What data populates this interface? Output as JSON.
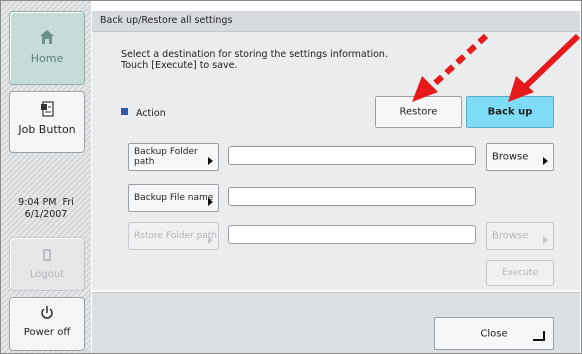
{
  "sidebar": {
    "home_label": "Home",
    "job_label": "Job Button",
    "time": "9:04 PM  Fri",
    "date": "6/1/2007",
    "logout_label": "Logout",
    "power_label": "Power off"
  },
  "window": {
    "title": "Back up/Restore all settings"
  },
  "instructions": {
    "line1": "Select a destination for storing the settings information.",
    "line2": "Touch [Execute] to save."
  },
  "action": {
    "label": "Action",
    "restore_label": "Restore",
    "backup_label": "Back up",
    "selected": "Back up"
  },
  "fields": {
    "backup_folder_label": "Backup Folder path",
    "backup_folder_value": "",
    "backup_file_label": "Backup File name",
    "backup_file_value": "",
    "restore_folder_label": "Rstore Folder path",
    "restore_folder_value": ""
  },
  "buttons": {
    "browse_label": "Browse",
    "browse_disabled_label": "Browse",
    "execute_label": "Execute",
    "close_label": "Close"
  },
  "colors": {
    "accent_selected": "#7fdcf7",
    "annotation_arrow": "#e8191b"
  }
}
